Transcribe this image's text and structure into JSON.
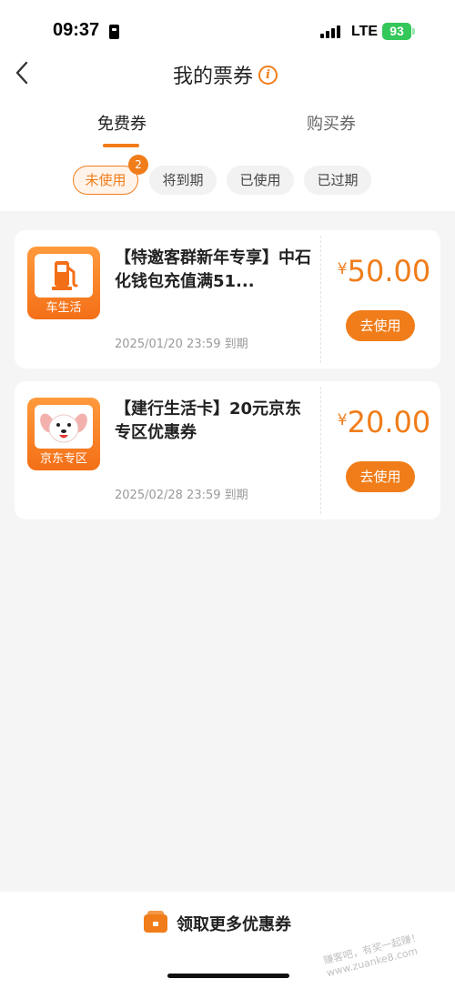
{
  "status_bar": {
    "time": "09:37",
    "network": "LTE",
    "battery": "93"
  },
  "nav": {
    "title": "我的票券",
    "info_icon": "i"
  },
  "main_tabs": [
    {
      "label": "免费券",
      "active": true
    },
    {
      "label": "购买券",
      "active": false
    }
  ],
  "filters": [
    {
      "label": "未使用",
      "active": true,
      "badge": "2"
    },
    {
      "label": "将到期",
      "active": false
    },
    {
      "label": "已使用",
      "active": false
    },
    {
      "label": "已过期",
      "active": false
    }
  ],
  "coupons": [
    {
      "logo_caption": "车生活",
      "logo_icon": "gas-pump-icon",
      "title": "【特邀客群新年专享】中石化钱包充值满51...",
      "expire": "2025/01/20 23:59 到期",
      "currency": "¥",
      "amount": "50.00",
      "button": "去使用"
    },
    {
      "logo_caption": "京东专区",
      "logo_icon": "jd-dog-mascot-icon",
      "title": "【建行生活卡】20元京东专区优惠券",
      "expire": "2025/02/28 23:59 到期",
      "currency": "¥",
      "amount": "20.00",
      "button": "去使用"
    }
  ],
  "bottom": {
    "label": "领取更多优惠券",
    "icon": "ticket-icon"
  },
  "watermark": "赚客吧，有奖一起赚！www.zuanke8.com",
  "colors": {
    "accent": "#f07d1a",
    "background": "#f5f5f5"
  }
}
